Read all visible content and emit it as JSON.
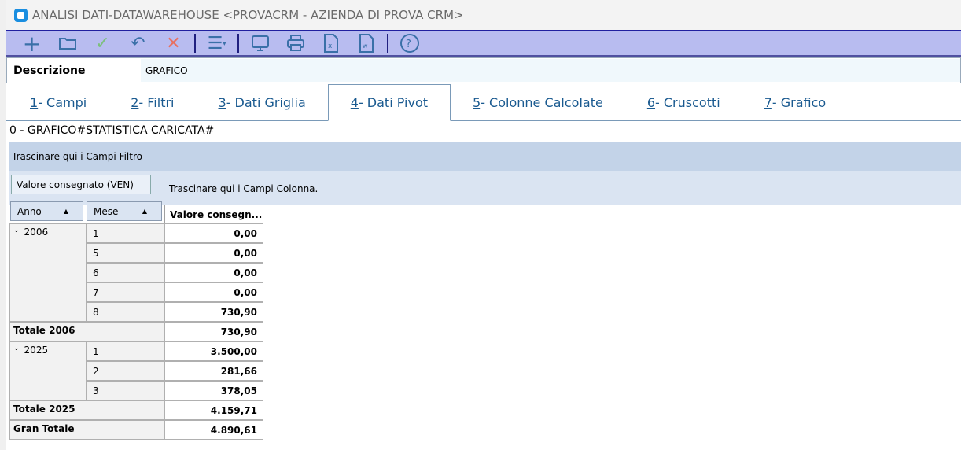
{
  "window": {
    "title": "ANALISI DATI-DATAWAREHOUSE <PROVACRM - AZIENDA DI PROVA CRM>"
  },
  "toolbar": [
    "add-icon",
    "open-folder-icon",
    "confirm-icon",
    "undo-icon",
    "cancel-icon",
    "menu-icon",
    "monitor-icon",
    "print-icon",
    "excel-icon",
    "word-icon",
    "help-icon"
  ],
  "description": {
    "label": "Descrizione",
    "value": "GRAFICO"
  },
  "tabs": [
    {
      "num": "1",
      "label": " - Campi"
    },
    {
      "num": "2",
      "label": " - Filtri"
    },
    {
      "num": "3",
      "label": " - Dati Griglia"
    },
    {
      "num": "4",
      "label": " - Dati Pivot"
    },
    {
      "num": "5",
      "label": " - Colonne Calcolate"
    },
    {
      "num": "6",
      "label": " - Cruscotti"
    },
    {
      "num": "7",
      "label": " - Grafico"
    }
  ],
  "status": "0 - GRAFICO#STATISTICA CARICATA#",
  "pivot": {
    "filter_hint": "Trascinare qui i Campi Filtro",
    "data_field": "Valore consegnato (VEN)",
    "column_hint": "Trascinare qui i Campi Colonna.",
    "row_fields": [
      "Anno",
      "Mese"
    ],
    "value_header": "Valore consegn...",
    "groups": [
      {
        "year": "2006",
        "rows": [
          [
            "1",
            "0,00"
          ],
          [
            "5",
            "0,00"
          ],
          [
            "6",
            "0,00"
          ],
          [
            "7",
            "0,00"
          ],
          [
            "8",
            "730,90"
          ]
        ],
        "total_label": "Totale 2006",
        "total": "730,90"
      },
      {
        "year": "2025",
        "rows": [
          [
            "1",
            "3.500,00"
          ],
          [
            "2",
            "281,66"
          ],
          [
            "3",
            "378,05"
          ]
        ],
        "total_label": "Totale 2025",
        "total": "4.159,71"
      }
    ],
    "grand_total_label": "Gran Totale",
    "grand_total": "4.890,61"
  }
}
